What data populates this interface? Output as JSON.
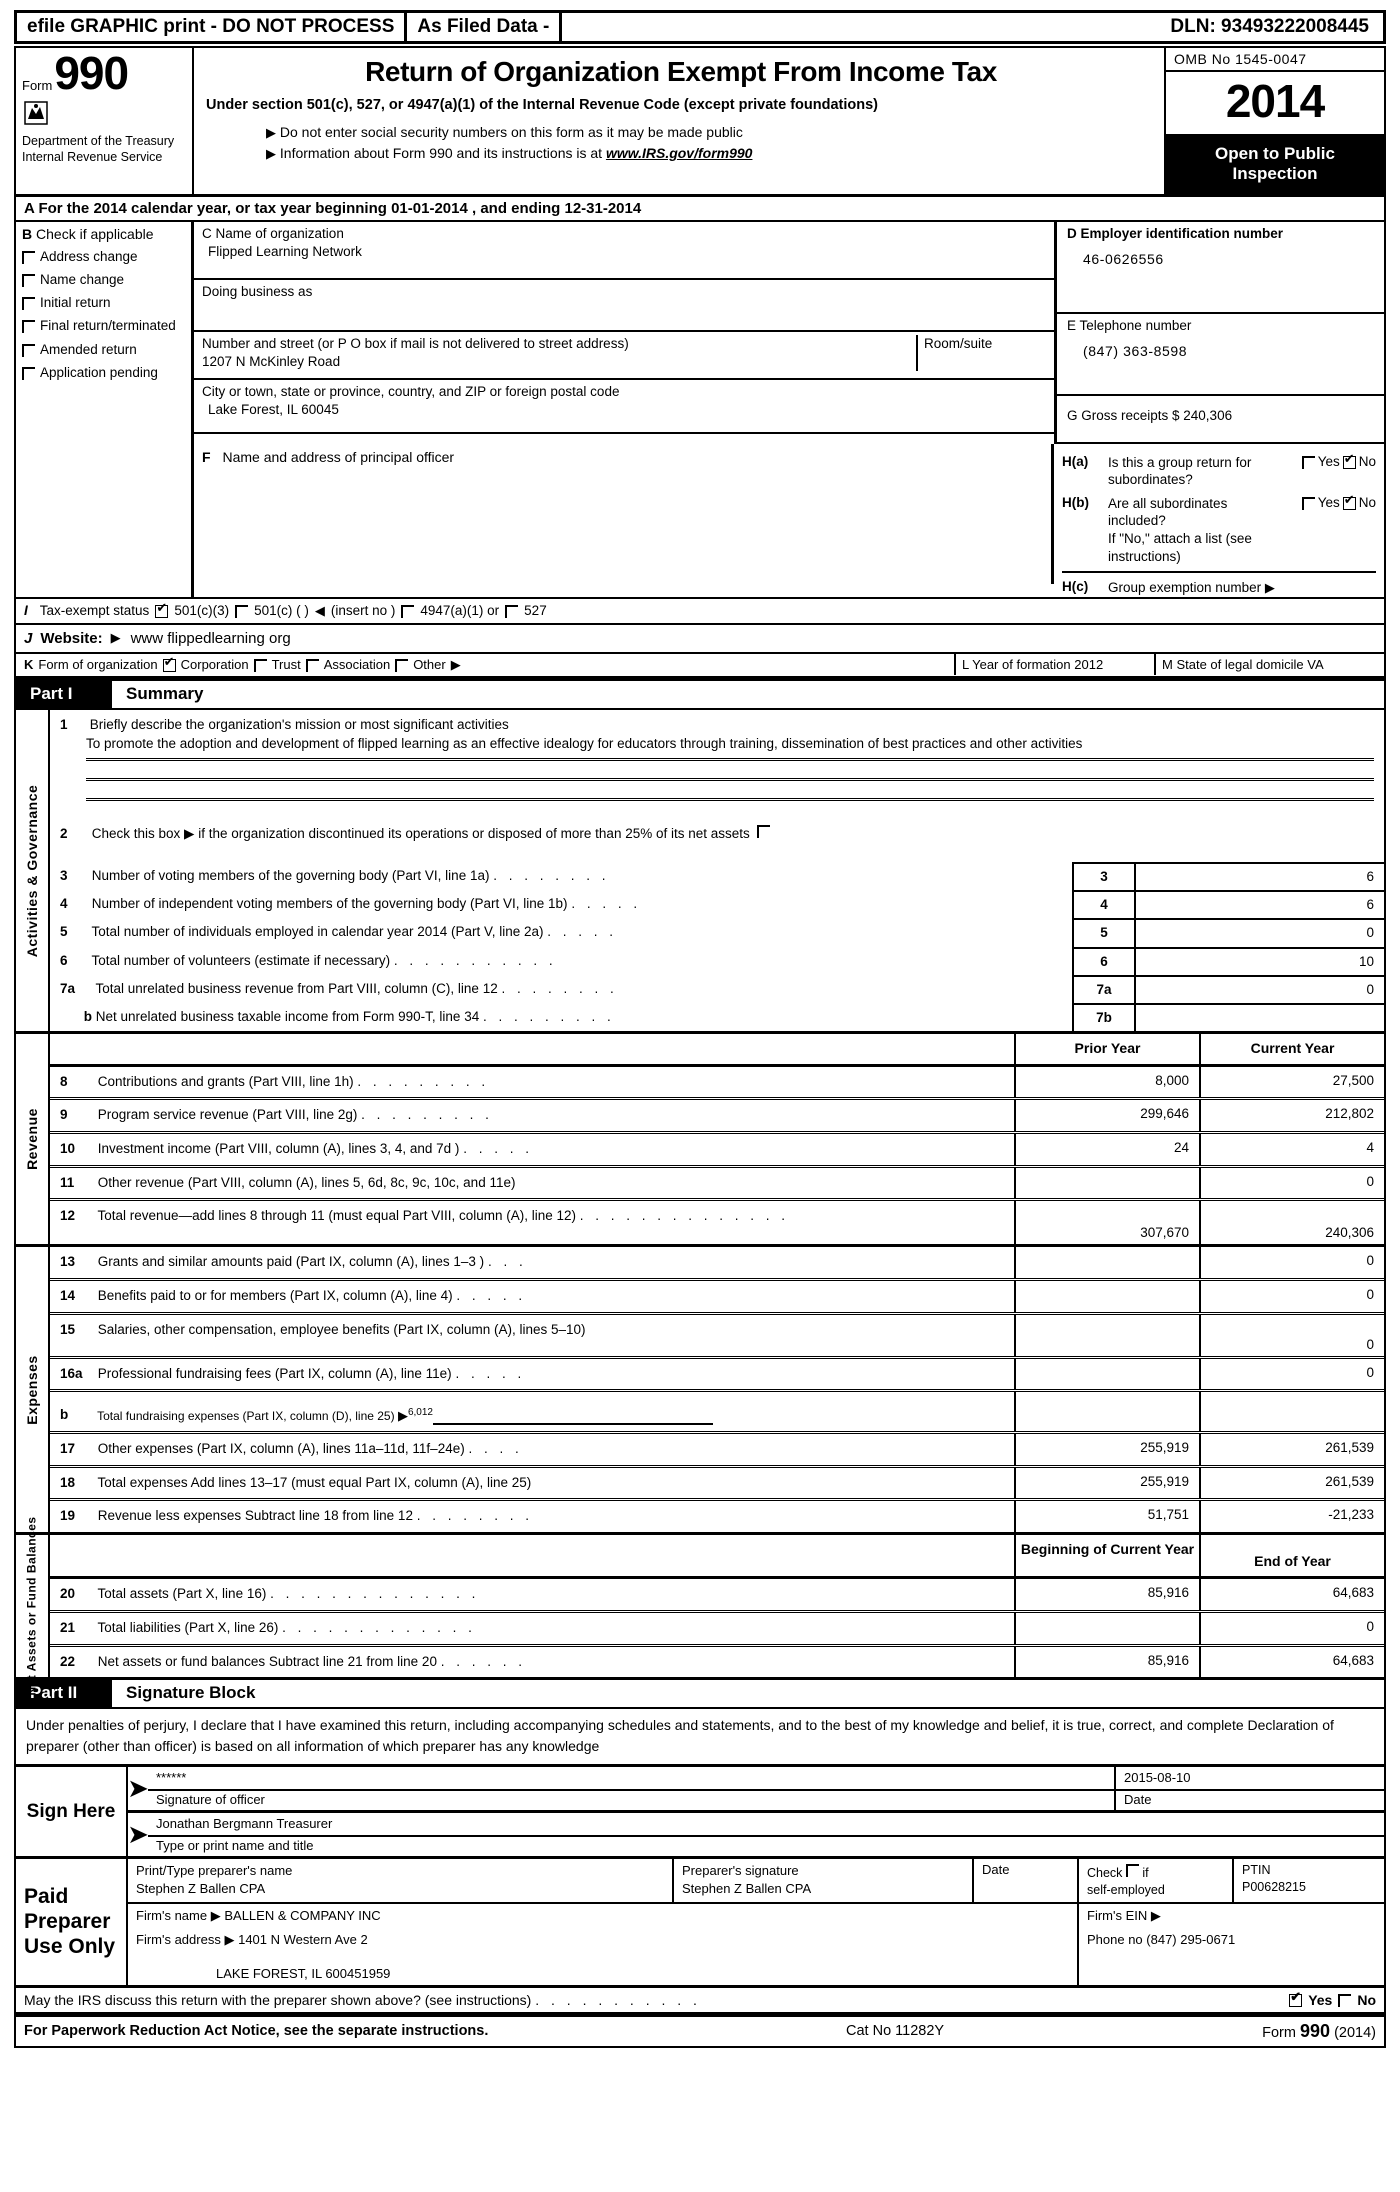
{
  "efile_bar": {
    "graphic_print": "efile GRAPHIC print - DO NOT PROCESS",
    "as_filed": "As Filed Data -",
    "dln": "DLN: 93493222008445"
  },
  "header": {
    "form_label": "Form",
    "form_number": "990",
    "department": "Department of the Treasury",
    "service": "Internal Revenue Service",
    "title": "Return of Organization Exempt From Income Tax",
    "subtitle": "Under section 501(c), 527, or 4947(a)(1) of the Internal Revenue Code (except private foundations)",
    "bullet1": "Do not enter social security numbers on this form as it may be made public",
    "bullet2_pre": "Information about Form 990 and its instructions is at ",
    "bullet2_link": "www.IRS.gov/form990",
    "omb": "OMB No 1545-0047",
    "tax_year": "2014",
    "open_to_public": "Open to Public",
    "inspection": "Inspection"
  },
  "section_a": {
    "text": "A  For the 2014 calendar year, or tax year beginning 01-01-2014    , and ending 12-31-2014"
  },
  "section_b": {
    "letter": "B",
    "heading": "Check if applicable",
    "options": [
      {
        "label": "Address change",
        "checked": false
      },
      {
        "label": "Name change",
        "checked": false
      },
      {
        "label": "Initial return",
        "checked": false
      },
      {
        "label": "Final return/terminated",
        "checked": false
      },
      {
        "label": "Amended return",
        "checked": false
      },
      {
        "label": "Application pending",
        "checked": false
      }
    ]
  },
  "section_c": {
    "name_label": "C Name of organization",
    "name_value": "Flipped Learning Network",
    "dba_label": "Doing business as",
    "dba_value": "",
    "street_label": "Number and street (or P O  box if mail is not delivered to street address)",
    "street_value": "1207 N McKinley Road",
    "room_label": "Room/suite",
    "room_value": "",
    "city_label": "City or town, state or province, country, and ZIP or foreign postal code",
    "city_value": "Lake Forest, IL  60045"
  },
  "section_d": {
    "ein_label": "D Employer identification number",
    "ein_value": "46-0626556",
    "phone_label": "E Telephone number",
    "phone_value": "(847) 363-8598",
    "gross_label": "G Gross receipts $ 240,306"
  },
  "section_f": {
    "label": "F",
    "text": "Name and address of principal officer",
    "value": ""
  },
  "section_h": {
    "ha_key": "H(a)",
    "ha_text": "Is this a group return for subordinates?",
    "ha_yes": "Yes",
    "ha_no": "No",
    "ha_answer": "No",
    "hb_key": "H(b)",
    "hb_text": "Are all subordinates included?",
    "hb_yes": "Yes",
    "hb_no": "No",
    "hb_answer": "No",
    "hb_note": "If \"No,\" attach a list  (see instructions)",
    "hc_key": "H(c)",
    "hc_text": "Group exemption number",
    "hc_value": ""
  },
  "section_i": {
    "letter": "I",
    "label": "Tax-exempt status",
    "options": [
      {
        "label": "501(c)(3)",
        "checked": true
      },
      {
        "label": "501(c) (    )",
        "checked": false
      },
      {
        "label": "4947(a)(1) or",
        "checked": false
      },
      {
        "label": "527",
        "checked": false
      }
    ],
    "insert_no": "(insert no )"
  },
  "section_j": {
    "letter": "J",
    "label": "Website:",
    "value": "www flippedlearning org"
  },
  "section_k": {
    "letter": "K",
    "label": "Form of organization",
    "options": [
      {
        "label": "Corporation",
        "checked": true
      },
      {
        "label": "Trust",
        "checked": false
      },
      {
        "label": "Association",
        "checked": false
      },
      {
        "label": "Other",
        "checked": false
      }
    ],
    "l_label": "L Year of formation  2012",
    "m_label": "M State of legal domicile  VA"
  },
  "part1": {
    "part_label": "Part I",
    "part_title": "Summary",
    "vertical_label": "Activities & Governance",
    "line1_num": "1",
    "line1_label": "Briefly describe the organization's mission or most significant activities",
    "line1_value": "To promote the adoption and development of flipped learning as an effective idealogy for educators through training, dissemination of best practices and other activities",
    "line2_num": "2",
    "line2_text": "Check this box ▶ if the organization discontinued its operations or disposed of more than 25% of its net assets",
    "line2_checked": false,
    "rows": [
      {
        "num": "3",
        "text": "Number of voting members of the governing body (Part VI, line 1a)",
        "dots": ". . . . . . . .",
        "key": "3",
        "value": "6"
      },
      {
        "num": "4",
        "text": "Number of independent voting members of the governing body (Part VI, line 1b)",
        "dots": ". . . . .",
        "key": "4",
        "value": "6"
      },
      {
        "num": "5",
        "text": "Total number of individuals employed in calendar year 2014 (Part V, line 2a)",
        "dots": ". . . . .",
        "key": "5",
        "value": "0"
      },
      {
        "num": "6",
        "text": "Total number of volunteers (estimate if necessary)",
        "dots": ". . . . . . . . . . .",
        "key": "6",
        "value": "10"
      },
      {
        "num": "7a",
        "text": "Total unrelated business revenue from Part VIII, column (C), line 12",
        "dots": ". . . . . . . .",
        "key": "7a",
        "value": "0"
      },
      {
        "num": "b",
        "text": "Net unrelated business taxable income from Form 990-T, line 34",
        "dots": ". . . . . . . . .",
        "key": "7b",
        "value": ""
      }
    ]
  },
  "revenue": {
    "vertical_label": "Revenue",
    "col_prior": "Prior Year",
    "col_current": "Current Year",
    "rows": [
      {
        "num": "8",
        "text": "Contributions and grants (Part VIII, line 1h)",
        "dots": ". . . . . . . . .",
        "prior": "8,000",
        "current": "27,500"
      },
      {
        "num": "9",
        "text": "Program service revenue (Part VIII, line 2g)",
        "dots": ". . . . . . . . .",
        "prior": "299,646",
        "current": "212,802"
      },
      {
        "num": "10",
        "text": "Investment income (Part VIII, column (A), lines 3, 4, and 7d )",
        "dots": ". . . . .",
        "prior": "24",
        "current": "4"
      },
      {
        "num": "11",
        "text": "Other revenue (Part VIII, column (A), lines 5, 6d, 8c, 9c, 10c, and 11e)",
        "dots": "",
        "prior": "",
        "current": "0"
      },
      {
        "num": "12",
        "text": "Total revenue—add lines 8 through 11 (must equal Part VIII, column (A), line 12)",
        "dots": ". . . . . . . . . . . . . .",
        "prior": "307,670",
        "current": "240,306"
      }
    ]
  },
  "expenses": {
    "vertical_label": "Expenses",
    "rows": [
      {
        "num": "13",
        "text": "Grants and similar amounts paid (Part IX, column (A), lines 1–3 )",
        "dots": ". . .",
        "prior": "",
        "current": "0"
      },
      {
        "num": "14",
        "text": "Benefits paid to or for members (Part IX, column (A), line 4)",
        "dots": ". . . . .",
        "prior": "",
        "current": "0"
      },
      {
        "num": "15",
        "text": "Salaries, other compensation, employee benefits (Part IX, column (A), lines 5–10)",
        "dots": "",
        "prior": "",
        "current": "0"
      },
      {
        "num": "16a",
        "text": "Professional fundraising fees (Part IX, column (A), line 11e)",
        "dots": ". . . . .",
        "prior": "",
        "current": "0"
      },
      {
        "num": "b",
        "text": "Total fundraising expenses (Part IX, column (D), line 25)",
        "dots": "",
        "prior": "",
        "current": "",
        "inline_value": "6,012"
      },
      {
        "num": "17",
        "text": "Other expenses (Part IX, column (A), lines 11a–11d, 11f–24e)",
        "dots": ". . . .",
        "prior": "255,919",
        "current": "261,539"
      },
      {
        "num": "18",
        "text": "Total expenses  Add lines 13–17 (must equal Part IX, column (A), line 25)",
        "dots": "",
        "prior": "255,919",
        "current": "261,539"
      },
      {
        "num": "19",
        "text": "Revenue less expenses  Subtract line 18 from line 12",
        "dots": ". . . . . . . .",
        "prior": "51,751",
        "current": "-21,233"
      }
    ]
  },
  "netassets": {
    "vertical_label": "Net Assets or Fund Balances",
    "col_begin": "Beginning of Current Year",
    "col_end": "End of Year",
    "rows": [
      {
        "num": "20",
        "text": "Total assets (Part X, line 16)",
        "dots": ". . . . . . . . . . . . . .",
        "begin": "85,916",
        "end": "64,683"
      },
      {
        "num": "21",
        "text": "Total liabilities (Part X, line 26)",
        "dots": ". . . . . . . . . . . . .",
        "begin": "",
        "end": "0"
      },
      {
        "num": "22",
        "text": "Net assets or fund balances  Subtract line 21 from line 20",
        "dots": ". . . . . .",
        "begin": "85,916",
        "end": "64,683"
      }
    ]
  },
  "part2": {
    "part_label": "Part II",
    "part_title": "Signature Block",
    "perjury": "Under penalties of perjury, I declare that I have examined this return, including accompanying schedules and statements, and to the best of my knowledge and belief, it is true, correct, and complete  Declaration of preparer (other than officer) is based on all information of which preparer has any knowledge",
    "sign_here": "Sign Here",
    "signature_value": "******",
    "signature_caption": "Signature of officer",
    "date_value": "2015-08-10",
    "date_caption": "Date",
    "name_title_value": "Jonathan Bergmann Treasurer",
    "name_title_caption": "Type or print name and title"
  },
  "preparer": {
    "paid_label": "Paid Preparer Use Only",
    "name_caption": "Print/Type preparer's name",
    "name_value": "Stephen Z Ballen CPA",
    "sig_caption": "Preparer's signature",
    "sig_value": "Stephen Z Ballen CPA",
    "date_caption": "Date",
    "date_value": "",
    "check_caption": "Check",
    "check_if": "if",
    "self_employed": "self-employed",
    "self_employed_checked": false,
    "ptin_caption": "PTIN",
    "ptin_value": "P00628215",
    "firm_name_caption": "Firm's name",
    "firm_name_value": "BALLEN & COMPANY INC",
    "firm_address_caption": "Firm's address",
    "firm_address_value": "1401 N Western Ave 2",
    "firm_city_value": "LAKE FOREST, IL  600451959",
    "firm_ein_caption": "Firm's EIN",
    "firm_ein_value": "",
    "phone_caption": "Phone no  (847) 295-0671"
  },
  "footer": {
    "irs_question": "May the IRS discuss this return with the preparer shown above? (see instructions)",
    "irs_dots": ". . . . . . . . . . .",
    "yes": "Yes",
    "no": "No",
    "answer": "Yes",
    "paperwork": "For Paperwork Reduction Act Notice, see the separate instructions.",
    "cat_no": "Cat No  11282Y",
    "form_label": "Form",
    "form_number": "990",
    "form_year": "(2014)"
  }
}
